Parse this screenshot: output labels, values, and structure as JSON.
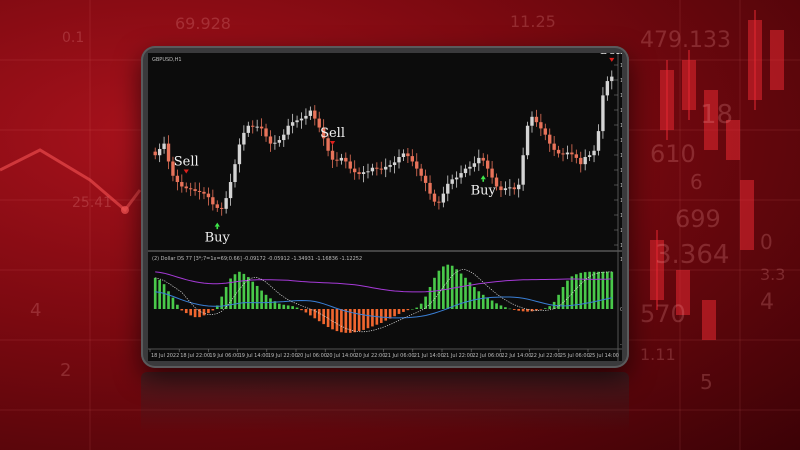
{
  "background_numbers": [
    "69.928",
    "11.25",
    "479.133",
    "0.1",
    "18",
    "699",
    "3.364",
    "3.3",
    "570",
    "610",
    "6",
    "4",
    "25.41",
    "4",
    "2",
    "5",
    "0",
    "1.11"
  ],
  "colors": {
    "bull": "#d4d4d4",
    "bear": "#e8735a",
    "hist_pos": "#49c94a",
    "hist_neg": "#f0662f",
    "sell_arrow": "#e0201c",
    "buy_arrow": "#3ee84a",
    "ind_purple": "#a63ad8",
    "ind_blue": "#3a7fd6"
  },
  "chart": {
    "symbol": "GBPUSD,H1",
    "price_ticks": [
      "1.20860",
      "1.20695",
      "1.20525",
      "1.20355",
      "1.20190",
      "1.20020",
      "1.19850",
      "1.19685",
      "1.19515",
      "1.19345",
      "1.19180",
      "1.19010",
      "1.18845"
    ],
    "indicator_label": "(2) Dollar DS 77 [3*;7=1x=69;0.66] -0.09172 -0.05912 -1.34931 -1.16836 -1.12252",
    "indicator_ticks": [
      "1.46625",
      "0.00",
      "-1.23835"
    ],
    "time_labels": [
      "18 Jul 2022",
      "18 Jul 22:00",
      "19 Jul 06:00",
      "19 Jul 14:00",
      "19 Jul 22:00",
      "20 Jul 06:00",
      "20 Jul 14:00",
      "20 Jul 22:00",
      "21 Jul 06:00",
      "21 Jul 14:00",
      "21 Jul 22:00",
      "22 Jul 06:00",
      "22 Jul 14:00",
      "22 Jul 22:00",
      "25 Jul 06:00",
      "25 Jul 14:00"
    ],
    "signals": [
      {
        "label": "Sell",
        "type": "sell",
        "bar": 7
      },
      {
        "label": "Buy",
        "type": "buy",
        "bar": 14
      },
      {
        "label": "Sell",
        "type": "sell",
        "bar": 40
      },
      {
        "label": "Buy",
        "type": "buy",
        "bar": 74
      },
      {
        "label": "Sell",
        "type": "sell",
        "bar": 103
      },
      {
        "label": "Buy",
        "type": "buy",
        "bar": 110
      }
    ],
    "closes": [
      1.1985,
      1.1992,
      1.1998,
      1.1978,
      1.1962,
      1.1955,
      1.195,
      1.1948,
      1.1947,
      1.1945,
      1.1944,
      1.1942,
      1.1938,
      1.193,
      1.1926,
      1.1925,
      1.1937,
      1.1955,
      1.1975,
      1.1997,
      1.201,
      1.2018,
      1.2017,
      1.2017,
      1.2015,
      1.2006,
      1.1998,
      1.1999,
      1.2002,
      1.2008,
      1.2018,
      1.2022,
      1.2024,
      1.2026,
      1.2029,
      1.2035,
      1.2026,
      1.2016,
      1.2004,
      1.199,
      1.198,
      1.1979,
      1.1982,
      1.1978,
      1.197,
      1.1966,
      1.1964,
      1.1966,
      1.1967,
      1.1971,
      1.197,
      1.1969,
      1.1972,
      1.1974,
      1.1977,
      1.1983,
      1.1987,
      1.1984,
      1.1978,
      1.197,
      1.1962,
      1.1954,
      1.1942,
      1.1933,
      1.1932,
      1.1942,
      1.1953,
      1.1958,
      1.196,
      1.1965,
      1.197,
      1.1972,
      1.1976,
      1.1982,
      1.1979,
      1.197,
      1.196,
      1.195,
      1.1946,
      1.1948,
      1.1949,
      1.1947,
      1.1952,
      1.1985,
      1.2018,
      1.2028,
      1.2022,
      1.2015,
      1.2008,
      1.1998,
      1.1991,
      1.1987,
      1.1986,
      1.1988,
      1.1986,
      1.1982,
      1.1975,
      1.1983,
      1.1985,
      1.199,
      1.2012,
      1.2052,
      1.2068,
      1.2073
    ],
    "histogram": [
      0.88,
      0.82,
      0.7,
      0.5,
      0.32,
      0.12,
      -0.05,
      -0.14,
      -0.22,
      -0.28,
      -0.28,
      -0.22,
      -0.14,
      -0.05,
      0.1,
      0.35,
      0.62,
      0.86,
      0.98,
      1.05,
      0.99,
      0.9,
      0.77,
      0.65,
      0.52,
      0.4,
      0.3,
      0.22,
      0.15,
      0.12,
      0.1,
      0.08,
      0.04,
      -0.04,
      -0.12,
      -0.22,
      -0.32,
      -0.42,
      -0.52,
      -0.62,
      -0.7,
      -0.76,
      -0.8,
      -0.82,
      -0.82,
      -0.8,
      -0.76,
      -0.72,
      -0.66,
      -0.6,
      -0.54,
      -0.48,
      -0.4,
      -0.33,
      -0.25,
      -0.17,
      -0.1,
      -0.04,
      0.0,
      0.04,
      0.15,
      0.35,
      0.62,
      0.88,
      1.08,
      1.2,
      1.25,
      1.22,
      1.12,
      1.0,
      0.88,
      0.75,
      0.62,
      0.5,
      0.4,
      0.32,
      0.24,
      0.16,
      0.1,
      0.05,
      0.01,
      -0.03,
      -0.06,
      -0.08,
      -0.09,
      -0.08,
      -0.05,
      -0.02,
      0.02,
      0.08,
      0.2,
      0.4,
      0.62,
      0.8,
      0.92,
      0.98,
      1.02,
      1.04,
      1.05,
      1.05,
      1.05,
      1.05,
      1.05,
      1.05
    ]
  }
}
